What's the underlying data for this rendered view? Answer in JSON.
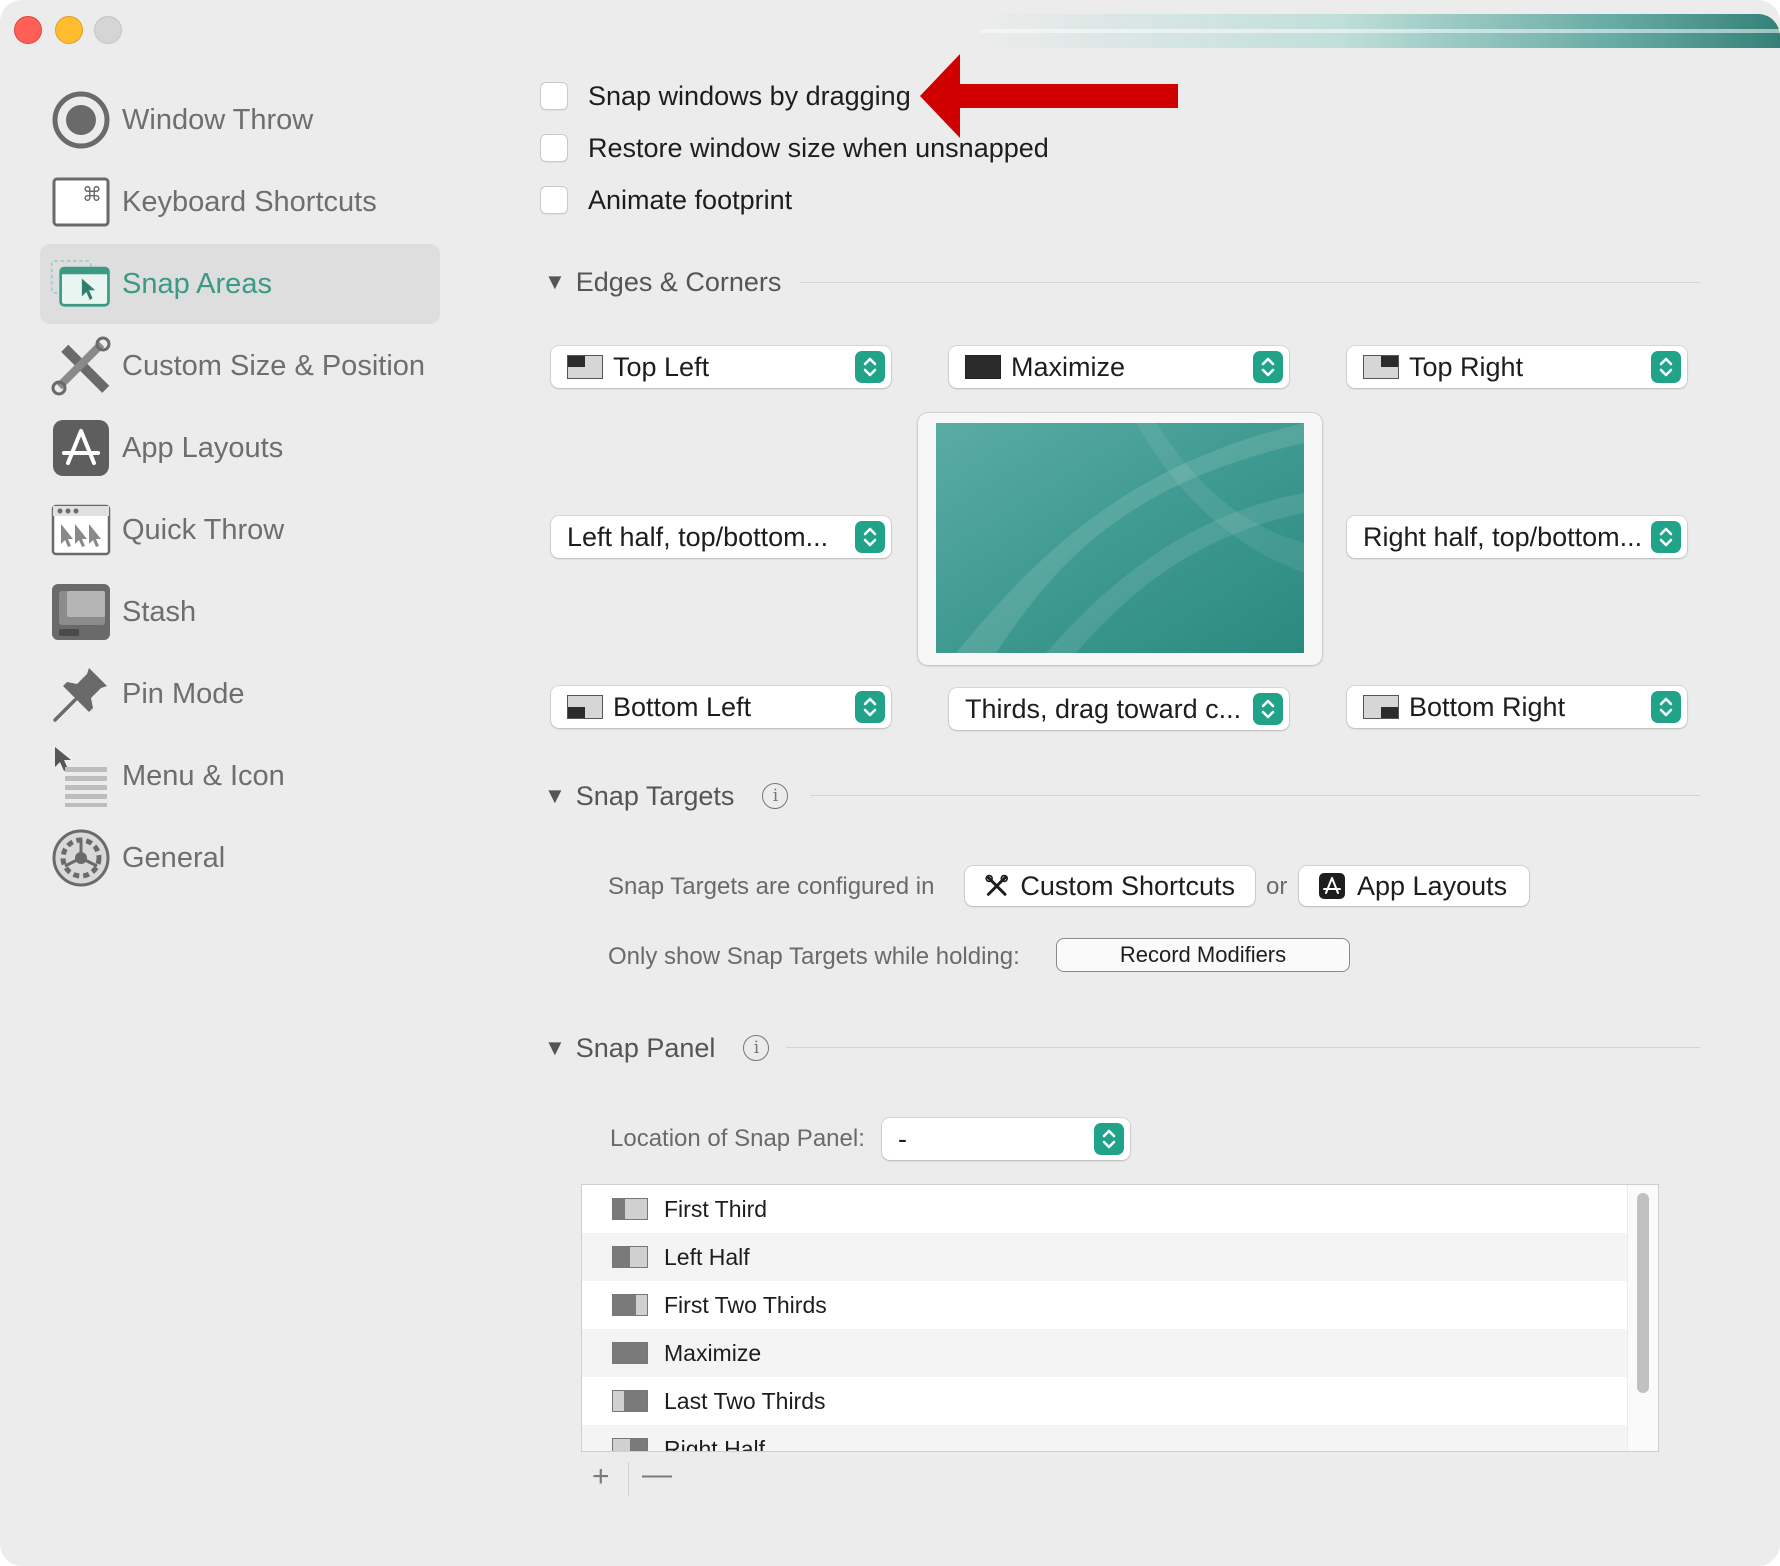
{
  "window": {
    "accent_color": "#21a38a"
  },
  "sidebar": {
    "items": [
      {
        "label": "Window Throw",
        "icon": "window-throw-icon"
      },
      {
        "label": "Keyboard Shortcuts",
        "icon": "keyboard-shortcuts-icon"
      },
      {
        "label": "Snap Areas",
        "icon": "snap-areas-icon",
        "selected": true
      },
      {
        "label": "Custom Size & Position",
        "icon": "custom-size-icon"
      },
      {
        "label": "App Layouts",
        "icon": "app-layouts-icon"
      },
      {
        "label": "Quick Throw",
        "icon": "quick-throw-icon"
      },
      {
        "label": "Stash",
        "icon": "stash-icon"
      },
      {
        "label": "Pin Mode",
        "icon": "pin-mode-icon"
      },
      {
        "label": "Menu & Icon",
        "icon": "menu-icon"
      },
      {
        "label": "General",
        "icon": "general-gear-icon"
      }
    ]
  },
  "options": {
    "snap_by_dragging": "Snap windows by dragging",
    "restore_size": "Restore window size when unsnapped",
    "animate_footprint": "Animate footprint"
  },
  "edges": {
    "title": "Edges & Corners",
    "top_left": "Top Left",
    "top_center": "Maximize",
    "top_right": "Top Right",
    "left": "Left half, top/bottom...",
    "right": "Right half, top/bottom...",
    "bottom_left": "Bottom Left",
    "bottom_center": "Thirds, drag toward c...",
    "bottom_right": "Bottom Right"
  },
  "targets": {
    "title": "Snap Targets",
    "configured_text": "Snap Targets are configured in",
    "custom_shortcuts": "Custom Shortcuts",
    "or": "or",
    "app_layouts": "App Layouts",
    "holding_text": "Only show Snap Targets while holding:",
    "record_button": "Record Modifiers"
  },
  "panel": {
    "title": "Snap Panel",
    "location_label": "Location of Snap Panel:",
    "location_value": "-",
    "list": [
      "First Third",
      "Left Half",
      "First Two Thirds",
      "Maximize",
      "Last Two Thirds",
      "Right Half"
    ],
    "add": "+",
    "remove": "—"
  }
}
